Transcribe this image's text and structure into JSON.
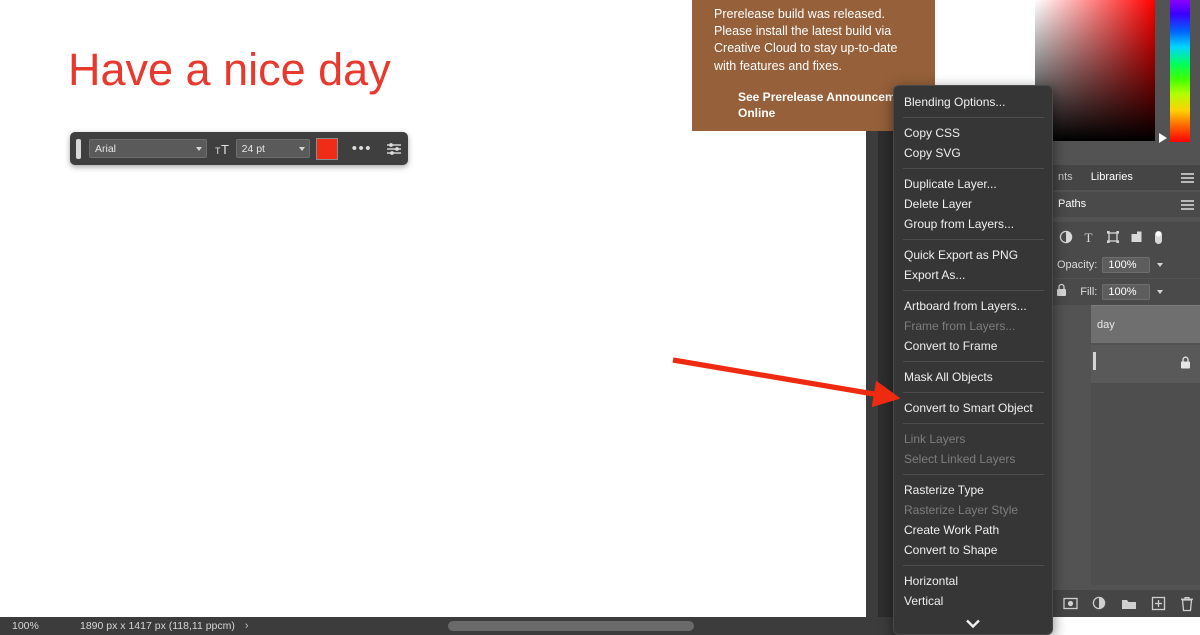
{
  "canvas": {
    "headline_text": "Have a nice day",
    "headline_color": "#e8392e"
  },
  "text_hud": {
    "font_family": "Arial",
    "font_size": "24 pt",
    "color_swatch": "#f02b18",
    "size_icon": "font-size-icon",
    "more_icon": "more-options-icon",
    "settings_icon": "text-settings-icon",
    "more_label": "•••"
  },
  "prerelease": {
    "body": "Prerelease build was released. Please install the latest build via Creative Cloud to stay up-to-date with features and fixes.",
    "link": "See Prerelease Announcements Online",
    "background": "#95603a"
  },
  "right_panel": {
    "top_tabs": [
      {
        "label": "nts"
      },
      {
        "label": "Libraries"
      }
    ],
    "second_tabs": [
      {
        "label": "Paths"
      }
    ],
    "opacity_label": "Opacity:",
    "opacity_value": "100%",
    "fill_label": "Fill:",
    "fill_value": "100%",
    "layer_rows": [
      {
        "name": "day"
      },
      {
        "name": ""
      }
    ],
    "filter_icons": [
      "adjustment-icon",
      "type-icon",
      "shape-icon",
      "smart-object-icon",
      "filter-toggle-icon"
    ],
    "footer_icons": [
      "layer-mask-icon",
      "adjustment-layer-icon",
      "new-group-icon",
      "new-layer-icon",
      "delete-layer-icon"
    ]
  },
  "context_menu": {
    "groups": [
      [
        "Blending Options..."
      ],
      [
        "Copy CSS",
        "Copy SVG"
      ],
      [
        "Duplicate Layer...",
        "Delete Layer",
        "Group from Layers..."
      ],
      [
        "Quick Export as PNG",
        "Export As..."
      ],
      [
        "Artboard from Layers...",
        "Frame from Layers...",
        "Convert to Frame"
      ],
      [
        "Mask All Objects"
      ],
      [
        "Convert to Smart Object"
      ],
      [
        "Link Layers",
        "Select Linked Layers"
      ],
      [
        "Rasterize Type",
        "Rasterize Layer Style",
        "Create Work Path",
        "Convert to Shape"
      ],
      [
        "Horizontal",
        "Vertical"
      ]
    ],
    "disabled_items": [
      "Frame from Layers...",
      "Link Layers",
      "Select Linked Layers",
      "Rasterize Layer Style"
    ],
    "scroll_down_icon": "chevron-down-icon"
  },
  "annotation": {
    "arrow_color": "#ee2b11"
  },
  "status_bar": {
    "zoom": "100%",
    "dimensions": "1890 px x 1417 px (118,11 ppcm)",
    "chevron": "›"
  }
}
